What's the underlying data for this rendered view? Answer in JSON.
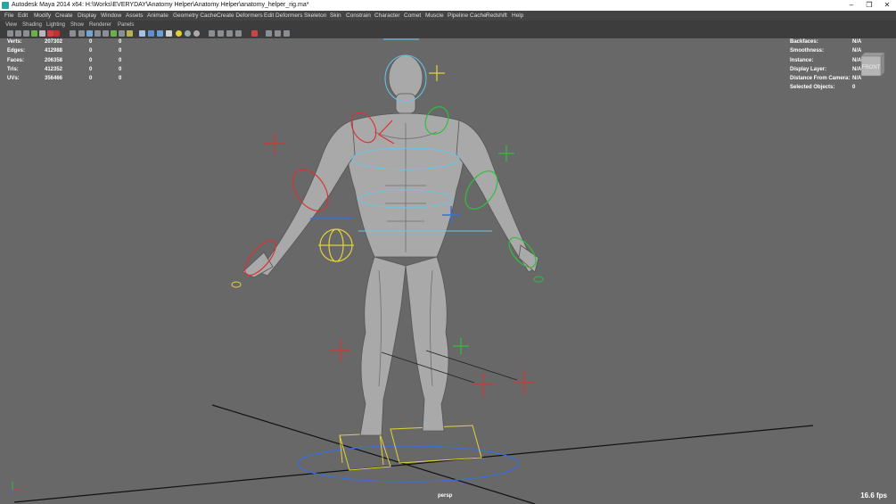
{
  "window": {
    "title": "Autodesk Maya 2014 x64: H:\\Works\\EVERYDAY\\Anatomy Helper\\Anatomy Helper\\anatomy_helper_rig.ma*",
    "minimize": "–",
    "restore": "❐",
    "close": "✕"
  },
  "menu": [
    "File",
    "Edit",
    "Modify",
    "Create",
    "Display",
    "Window",
    "Assets",
    "Animate",
    "Geometry Cache",
    "Create Deformers",
    "Edit Deformers",
    "Skeleton",
    "Skin",
    "Constrain",
    "Character",
    "Comet",
    "Muscle",
    "Pipeline Cache",
    "Redshift",
    "Help"
  ],
  "panel_menu": [
    "View",
    "Shading",
    "Lighting",
    "Show",
    "Renderer",
    "Panels"
  ],
  "hud_left": [
    {
      "label": "Verts:",
      "v1": "207302",
      "v2": "0",
      "v3": "0"
    },
    {
      "label": "Edges:",
      "v1": "412988",
      "v2": "0",
      "v3": "0"
    },
    {
      "label": "Faces:",
      "v1": "206358",
      "v2": "0",
      "v3": "0"
    },
    {
      "label": "Tris:",
      "v1": "412352",
      "v2": "0",
      "v3": "0"
    },
    {
      "label": "UVs:",
      "v1": "356466",
      "v2": "0",
      "v3": "0"
    }
  ],
  "hud_right": [
    {
      "label": "Backfaces:",
      "value": "N/A"
    },
    {
      "label": "Smoothness:",
      "value": "N/A"
    },
    {
      "label": "Instance:",
      "value": "N/A"
    },
    {
      "label": "Display Layer:",
      "value": "N/A"
    },
    {
      "label": "Distance From Camera:",
      "value": "N/A"
    },
    {
      "label": "Selected Objects:",
      "value": "0"
    }
  ],
  "viewcube_label": "FRONT",
  "camera_name": "persp",
  "fps": "16.6 fps",
  "colors": {
    "viewport_bg": "#686868",
    "control_red": "#d83434",
    "control_green": "#2fbf3a",
    "control_blue": "#3a6fd8",
    "control_yellow": "#e2d23a",
    "bone_cyan": "#66c6e8"
  },
  "icons": {
    "app": "maya-logo-icon",
    "axis": "axis-gizmo-icon"
  }
}
